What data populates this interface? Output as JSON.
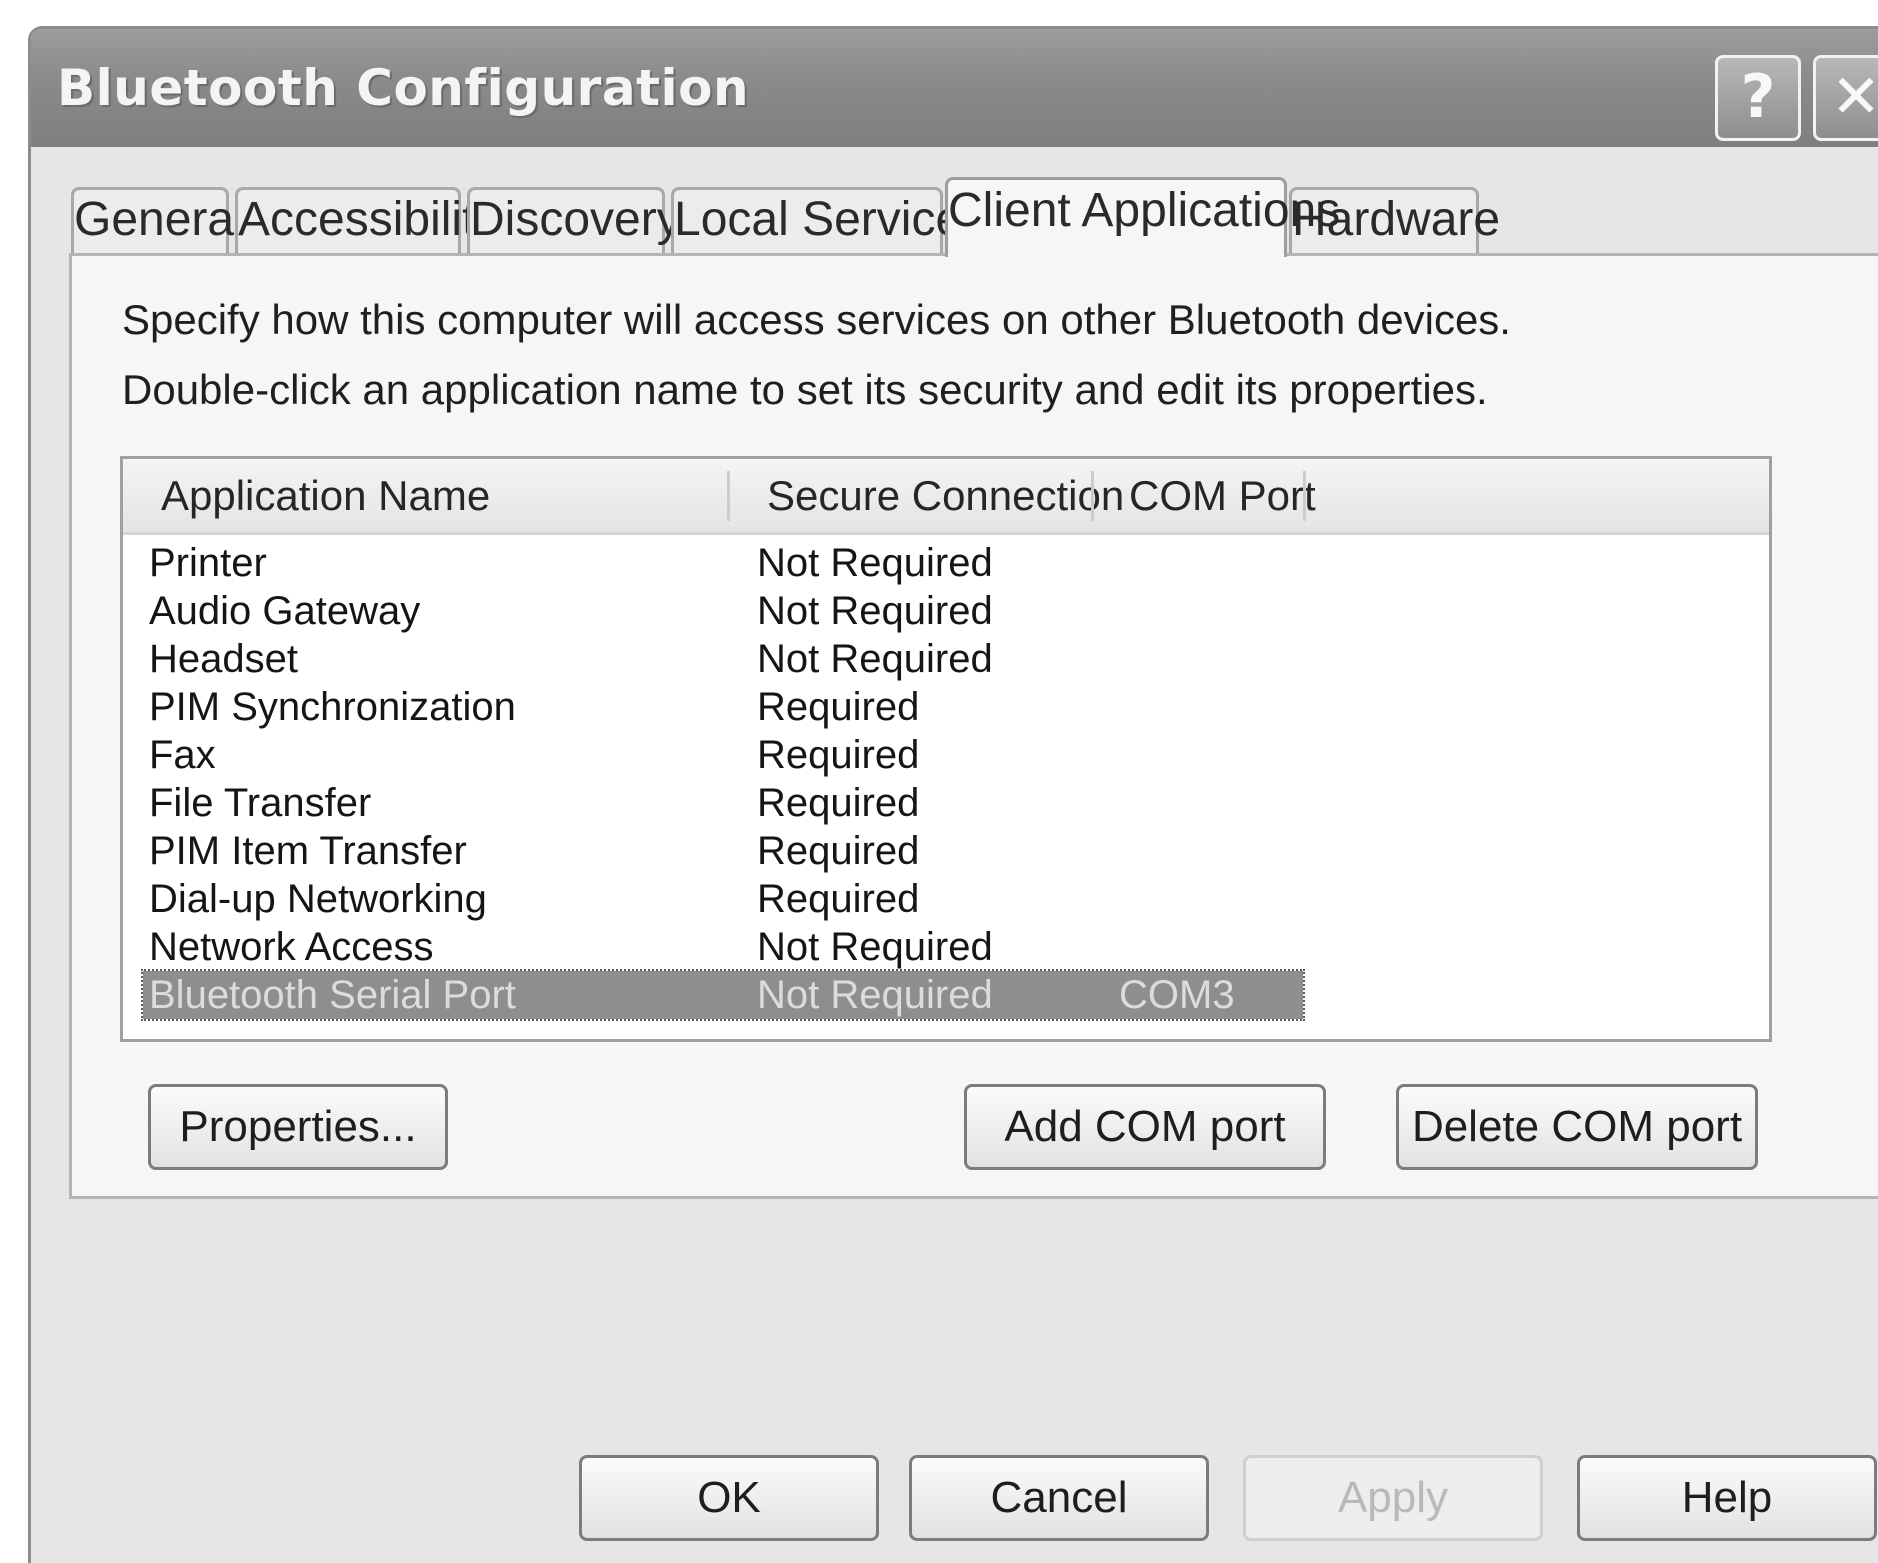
{
  "window": {
    "title": "Bluetooth Configuration",
    "help_glyph": "?",
    "close_glyph": "✕"
  },
  "tabs": [
    {
      "label": "General"
    },
    {
      "label": "Accessibility"
    },
    {
      "label": "Discovery"
    },
    {
      "label": "Local Services"
    },
    {
      "label": "Client Applications",
      "active": true
    },
    {
      "label": "Hardware"
    }
  ],
  "panel": {
    "instruction_1": "Specify how this computer will access services on other Bluetooth devices.",
    "instruction_2": "Double-click an application name to set its security and edit its properties."
  },
  "table": {
    "columns": [
      "Application Name",
      "Secure Connection",
      "COM Port"
    ],
    "rows": [
      {
        "name": "Printer",
        "secure": "Not Required",
        "com": ""
      },
      {
        "name": "Audio Gateway",
        "secure": "Not Required",
        "com": ""
      },
      {
        "name": "Headset",
        "secure": "Not Required",
        "com": ""
      },
      {
        "name": "PIM Synchronization",
        "secure": "Required",
        "com": ""
      },
      {
        "name": "Fax",
        "secure": "Required",
        "com": ""
      },
      {
        "name": "File Transfer",
        "secure": "Required",
        "com": ""
      },
      {
        "name": "PIM Item Transfer",
        "secure": "Required",
        "com": ""
      },
      {
        "name": "Dial-up Networking",
        "secure": "Required",
        "com": ""
      },
      {
        "name": "Network Access",
        "secure": "Not Required",
        "com": ""
      },
      {
        "name": "Bluetooth Serial Port",
        "secure": "Not Required",
        "com": "COM3",
        "selected": true
      }
    ]
  },
  "buttons": {
    "properties": "Properties...",
    "add_com_port": "Add COM port",
    "delete_com_port": "Delete COM port",
    "ok": "OK",
    "cancel": "Cancel",
    "apply": "Apply",
    "help": "Help"
  },
  "colors": {
    "titlebar": "#8a8a8a",
    "selection": "#8e8e8e",
    "dialog_bg": "#e6e6e6"
  }
}
